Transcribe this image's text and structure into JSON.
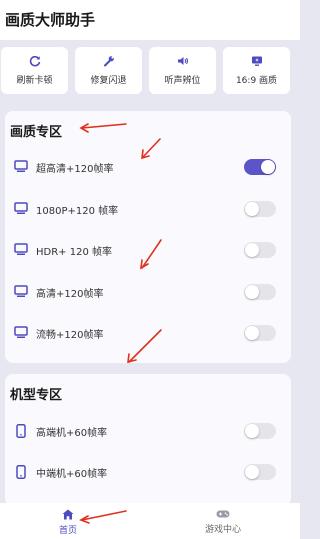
{
  "app": {
    "title": "画质大师助手"
  },
  "quick_actions": [
    {
      "icon": "refresh-icon",
      "label": "刷新卡顿"
    },
    {
      "icon": "wrench-icon",
      "label": "修复闪退"
    },
    {
      "icon": "speaker-icon",
      "label": "听声辨位"
    },
    {
      "icon": "monitor-icon",
      "label": "16:9 画质"
    }
  ],
  "quality_section": {
    "title": "画质专区",
    "items": [
      {
        "label": "超高清+120帧率",
        "enabled": true
      },
      {
        "label": "1080P+120 帧率",
        "enabled": false
      },
      {
        "label": "HDR+ 120 帧率",
        "enabled": false
      },
      {
        "label": "高清+120帧率",
        "enabled": false
      },
      {
        "label": "流畅+120帧率",
        "enabled": false
      }
    ]
  },
  "device_section": {
    "title": "机型专区",
    "items": [
      {
        "label": "高端机+60帧率",
        "enabled": false
      },
      {
        "label": "中端机+60帧率",
        "enabled": false
      }
    ]
  },
  "bottom_nav": [
    {
      "icon": "home-icon",
      "label": "首页",
      "active": true
    },
    {
      "icon": "gamepad-icon",
      "label": "游戏中心",
      "active": false
    }
  ],
  "colors": {
    "accent": "#5b55c9",
    "annotation_arrow": "#e0301e",
    "background": "#e7e7f1"
  }
}
